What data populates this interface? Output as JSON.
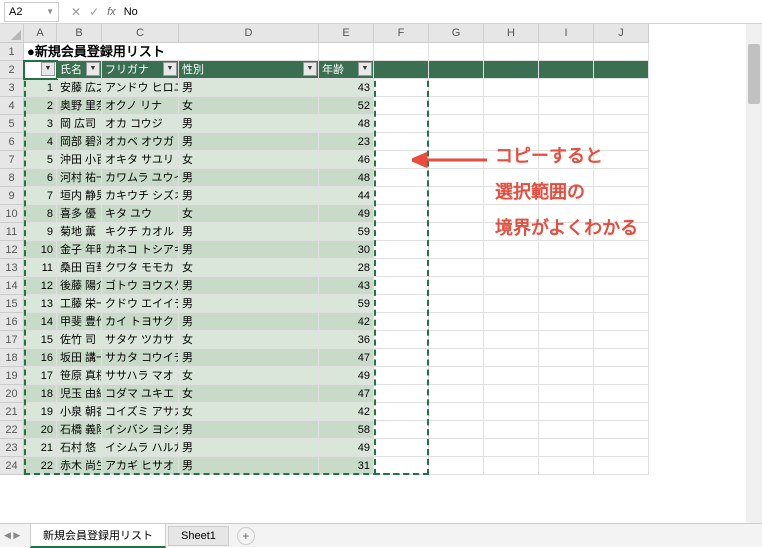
{
  "nameBox": "A2",
  "formulaValue": "No",
  "columns": [
    {
      "letter": "A",
      "w": 33
    },
    {
      "letter": "B",
      "w": 45
    },
    {
      "letter": "C",
      "w": 77
    },
    {
      "letter": "D",
      "w": 140
    },
    {
      "letter": "E",
      "w": 55
    },
    {
      "letter": "F",
      "w": 55
    },
    {
      "letter": "G",
      "w": 55
    },
    {
      "letter": "H",
      "w": 55
    },
    {
      "letter": "I",
      "w": 55
    },
    {
      "letter": "J",
      "w": 55
    }
  ],
  "title": "●新規会員登録用リスト",
  "headers": [
    "No",
    "氏名",
    "フリガナ",
    "性別",
    "年齢"
  ],
  "rows": [
    {
      "no": 1,
      "name": "安藤 広之",
      "kana": "アンドウ ヒロユキ",
      "sex": "男",
      "age": 43
    },
    {
      "no": 2,
      "name": "奥野 里奈",
      "kana": "オクノ リナ",
      "sex": "女",
      "age": 52
    },
    {
      "no": 3,
      "name": "岡 広司",
      "kana": "オカ コウジ",
      "sex": "男",
      "age": 48
    },
    {
      "no": 4,
      "name": "岡部 碧海",
      "kana": "オカベ オウガ",
      "sex": "男",
      "age": 23
    },
    {
      "no": 5,
      "name": "沖田 小百合",
      "kana": "オキタ サユリ",
      "sex": "女",
      "age": 46
    },
    {
      "no": 6,
      "name": "河村 祐一郎",
      "kana": "カワムラ ユウイチロウ",
      "sex": "男",
      "age": 48
    },
    {
      "no": 7,
      "name": "垣内 静男",
      "kana": "カキウチ シズオ",
      "sex": "男",
      "age": 44
    },
    {
      "no": 8,
      "name": "喜多 優",
      "kana": "キタ ユウ",
      "sex": "女",
      "age": 49
    },
    {
      "no": 9,
      "name": "菊地 薫",
      "kana": "キクチ カオル",
      "sex": "男",
      "age": 59
    },
    {
      "no": 10,
      "name": "金子 年昭",
      "kana": "カネコ トシアキ",
      "sex": "男",
      "age": 30
    },
    {
      "no": 11,
      "name": "桑田 百華",
      "kana": "クワタ モモカ",
      "sex": "女",
      "age": 28
    },
    {
      "no": 12,
      "name": "後藤 陽介",
      "kana": "ゴトウ ヨウスケ",
      "sex": "男",
      "age": 43
    },
    {
      "no": 13,
      "name": "工藤 栄一",
      "kana": "クドウ エイイチ",
      "sex": "男",
      "age": 59
    },
    {
      "no": 14,
      "name": "甲斐 豊作",
      "kana": "カイ トヨサク",
      "sex": "男",
      "age": 42
    },
    {
      "no": 15,
      "name": "佐竹 司",
      "kana": "サタケ ツカサ",
      "sex": "女",
      "age": 36
    },
    {
      "no": 16,
      "name": "坂田 講一",
      "kana": "サカタ コウイチ",
      "sex": "男",
      "age": 47
    },
    {
      "no": 17,
      "name": "笹原 真桜",
      "kana": "ササハラ マオ",
      "sex": "女",
      "age": 49
    },
    {
      "no": 18,
      "name": "児玉 由紀江",
      "kana": "コダマ ユキエ",
      "sex": "女",
      "age": 47
    },
    {
      "no": 19,
      "name": "小泉 朝香",
      "kana": "コイズミ アサカ",
      "sex": "女",
      "age": 42
    },
    {
      "no": 20,
      "name": "石橋 義隆",
      "kana": "イシバシ ヨシタカ",
      "sex": "男",
      "age": 58
    },
    {
      "no": 21,
      "name": "石村 悠",
      "kana": "イシムラ ハルカ",
      "sex": "男",
      "age": 49
    },
    {
      "no": 22,
      "name": "赤木 尚生",
      "kana": "アカギ ヒサオ",
      "sex": "男",
      "age": 31
    }
  ],
  "annotation": {
    "line1": "コピーすると",
    "line2": "選択範囲の",
    "line3": "境界がよくわかる"
  },
  "sheetTabs": {
    "active": "新規会員登録用リスト",
    "other": "Sheet1"
  }
}
